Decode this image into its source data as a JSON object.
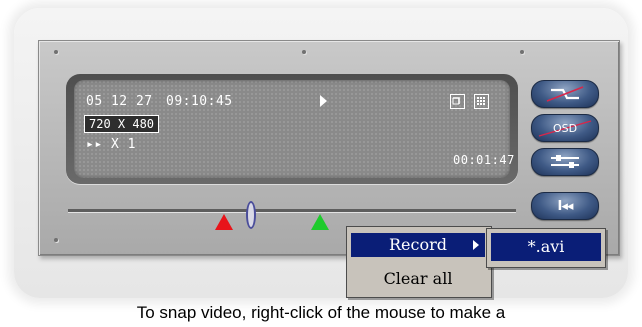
{
  "display": {
    "date": "05 12 27",
    "time": "09:10:45",
    "resolution": "720 X 480",
    "speed": "▸▸ X 1",
    "elapsed": "00:01:47"
  },
  "side_buttons": [
    {
      "label": "",
      "icon": "capture-icon"
    },
    {
      "label": "OSD",
      "icon": "osd-icon"
    },
    {
      "label": "",
      "icon": "settings-icon"
    },
    {
      "label": "I◂◂",
      "icon": "rewind-to-start-icon"
    }
  ],
  "context_menu": {
    "items": [
      {
        "label": "Record",
        "has_submenu": true,
        "highlighted": true
      },
      {
        "label": "Clear all",
        "has_submenu": false,
        "highlighted": false
      }
    ],
    "submenu": {
      "items": [
        {
          "label": "*.avi"
        }
      ]
    }
  },
  "caption": "To snap video, right-click of the mouse to make a",
  "colors": {
    "menu_highlight": "#0a1e77",
    "marker_start": "#e8141a",
    "marker_end": "#1ecb2c",
    "button_blue": "#3f5a86"
  }
}
